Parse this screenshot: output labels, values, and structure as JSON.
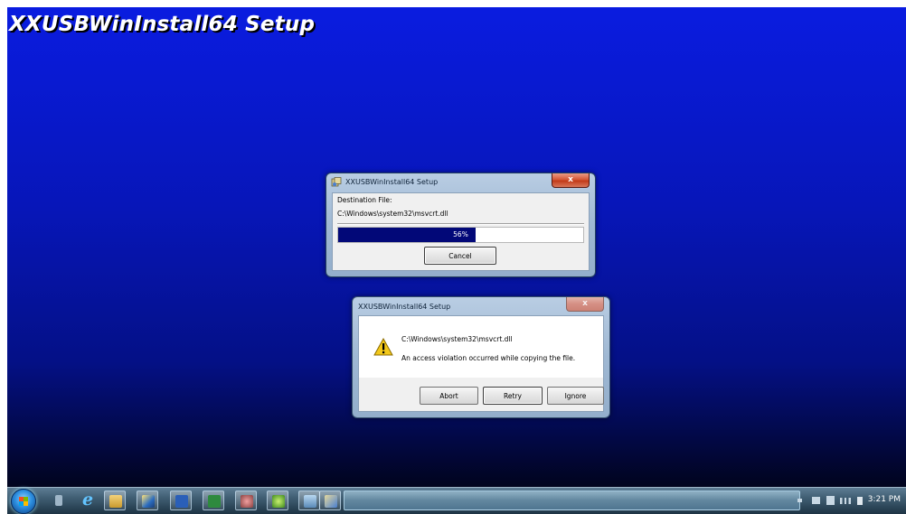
{
  "screen": {
    "title": "XXUSBWinInstall64 Setup"
  },
  "progress_dialog": {
    "title": "XXUSBWinInstall64 Setup",
    "close_glyph": "x",
    "destination_label": "Destination File:",
    "destination_path": "C:\\Windows\\system32\\msvcrt.dll",
    "progress_percent": 56,
    "progress_text": "56%",
    "cancel_label": "Cancel"
  },
  "error_dialog": {
    "title": "XXUSBWinInstall64 Setup",
    "close_glyph": "x",
    "icon": "warning-icon",
    "path": "C:\\Windows\\system32\\msvcrt.dll",
    "message": "An access violation occurred while copying the file.",
    "abort_label": "Abort",
    "retry_label": "Retry",
    "ignore_label": "Ignore"
  },
  "taskbar": {
    "items": [
      "start-orb",
      "explorer-icon",
      "internet-explorer-icon",
      "folder-icon",
      "media-icon",
      "word-icon",
      "excel-icon",
      "app-icon",
      "app-icon-2",
      "app-icon-3",
      "setup-icon"
    ],
    "clock": "3:21 PM"
  },
  "colors": {
    "desktop": "#0716b8",
    "progress_fill": "#020878",
    "taskbar": "#3f5d72"
  }
}
